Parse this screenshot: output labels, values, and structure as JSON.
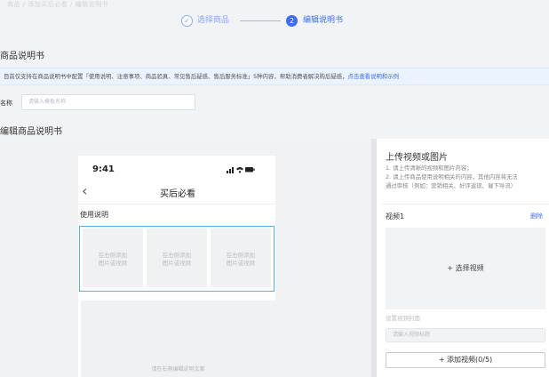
{
  "breadcrumb": "商品 / 添加买后必看 / 编辑说明书",
  "steps": {
    "step1": {
      "icon": "check-circle-icon",
      "label": "选择商品"
    },
    "step2": {
      "number": "2",
      "label": "编辑说明书"
    }
  },
  "section_title": "商品说明书",
  "notice": {
    "text": "目前仅支持在商品说明书中配置「使用说明、注意事项、商品验真、常见售后疑惑、售后服务标准」5种内容，帮助消费者解决购后疑惑，",
    "link": "点击查看说明和示例"
  },
  "name_field": {
    "label": "名称",
    "placeholder": "请输入模板名称"
  },
  "editor_title": "编辑商品说明书",
  "phone": {
    "time": "9:41",
    "status": "∥ ≈ ▬",
    "back": "‹",
    "nav_title": "买后必看",
    "section_label": "使用说明",
    "tiles": [
      "在右侧添加\n图片或视频",
      "在右侧添加\n图片或视频",
      "在右侧添加\n图片或视频"
    ],
    "text_hint": "请在右侧编辑说明文案"
  },
  "upload_panel": {
    "title": "上传视频或图片",
    "rules": [
      "1. 请上传清晰的视频和图片内容；",
      "2. 请上传商品使用说明相关的内容，其他内容将无法",
      "通过审核（例如：营销相关、好评返现、催下导流）"
    ],
    "video_label": "视频1",
    "delete_label": "删除",
    "select_video": "+ 选择视频",
    "cover_label": "设置视频封面",
    "title_placeholder": "请输入视频标题",
    "add_video": "+ 添加视频(0/5)"
  },
  "colors": {
    "accent": "#3b6cff",
    "notice_bg": "#eaf3ff",
    "selection": "#56b2e0"
  }
}
